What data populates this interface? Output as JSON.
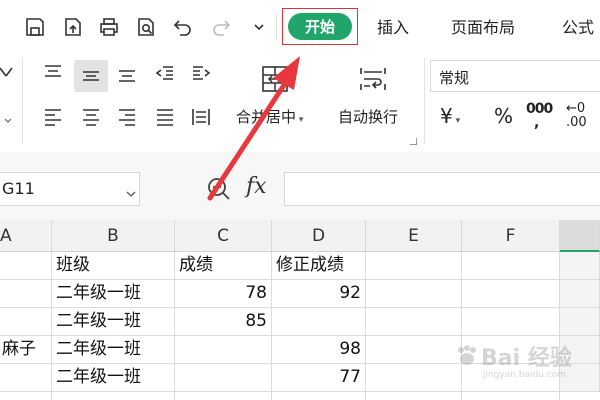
{
  "menu": {
    "tabs": [
      "开始",
      "插入",
      "页面布局",
      "公式"
    ]
  },
  "ribbon": {
    "merge_label": "合并居中",
    "wrap_label": "自动换行",
    "number_format": "常规",
    "currency_symbol": "¥",
    "percent_symbol": "%",
    "thousands_symbol": "000",
    "decimal_symbol": "←0 .00"
  },
  "formula_bar": {
    "cell_ref": "G11",
    "fx_label": "fx",
    "formula": ""
  },
  "sheet": {
    "columns": [
      "A",
      "B",
      "C",
      "D",
      "E",
      "F"
    ],
    "rows": [
      {
        "a": "",
        "b": "班级",
        "c": "成绩",
        "d": "修正成绩"
      },
      {
        "a": "",
        "b": "二年级一班",
        "c": "78",
        "d": "92"
      },
      {
        "a": "",
        "b": "二年级一班",
        "c": "85",
        "d": ""
      },
      {
        "a": "麻子",
        "b": "二年级一班",
        "c": "",
        "d": "98"
      },
      {
        "a": "",
        "b": "二年级一班",
        "c": "",
        "d": "77"
      }
    ]
  },
  "watermark": {
    "brand": "Bai 经验",
    "url": "jingyan.baidu.com"
  },
  "colors": {
    "active_tab": "#21a56a",
    "highlight_box": "#e0313a",
    "arrow": "#e8383d"
  }
}
